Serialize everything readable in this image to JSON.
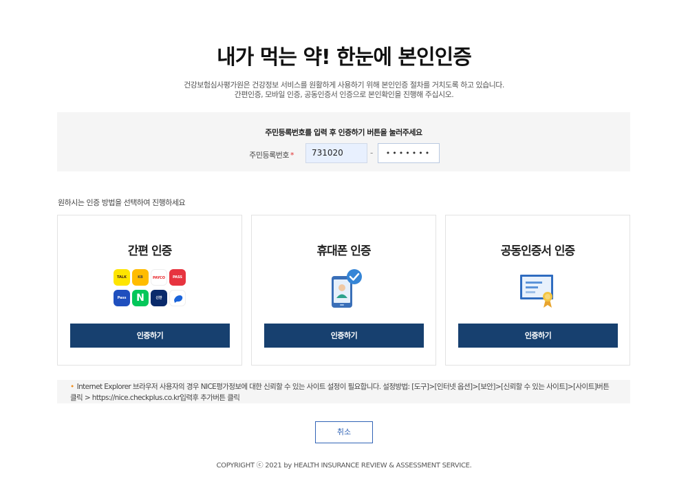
{
  "header": {
    "title": "내가 먹는 약! 한눈에 본인인증",
    "desc_line1": "건강보험심사평가원은 건강정보 서비스를 원활하게 사용하기 위해 본인인증 절차를 거치도록 하고 있습니다.",
    "desc_line2": "간편인증, 모바일 인증, 공동인증서 인증으로 본인확인을 진행해 주십시오."
  },
  "id_form": {
    "instruction": "주민등록번호를 입력 후 인증하기 버튼을 눌러주세요",
    "label": "주민등록번호",
    "required_mark": "*",
    "front_value": "731020",
    "separator": "-",
    "back_value": "•••••••"
  },
  "choose_text": "원하시는 인증 방법을 선택하여 진행하세요",
  "cards": [
    {
      "title": "간편 인증",
      "button": "인증하기"
    },
    {
      "title": "휴대폰 인증",
      "button": "인증하기"
    },
    {
      "title": "공동인증서 인증",
      "button": "인증하기"
    }
  ],
  "simple_auth_icons": [
    {
      "name": "kakao-icon",
      "text": "TALK",
      "bg": "#fee500",
      "fg": "#3a1d1d"
    },
    {
      "name": "kb-icon",
      "text": "KB",
      "bg": "#ffbc00",
      "fg": "#444"
    },
    {
      "name": "payco-icon",
      "text": "PAYCO",
      "bg": "#ffffff",
      "fg": "#e8262a"
    },
    {
      "name": "pass-icon",
      "text": "PASS",
      "bg": "#e7343f",
      "fg": "#fff"
    },
    {
      "name": "samsung-pass-icon",
      "text": "Pass",
      "bg": "#1f4fbe",
      "fg": "#fff"
    },
    {
      "name": "naver-icon",
      "text": "N",
      "bg": "#03c75a",
      "fg": "#fff"
    },
    {
      "name": "shinhan-icon",
      "text": "신한",
      "bg": "#0a2a6b",
      "fg": "#fff"
    },
    {
      "name": "toss-icon",
      "text": "",
      "bg": "#ffffff",
      "fg": "#1b64da"
    }
  ],
  "notice": {
    "line1": "Internet Explorer 브라우저 사용자의 경우 NICE평가정보에 대한 신뢰할 수 있는 사이트 설정이 필요합니다. 설정방법: [도구]>[인터넷 옵션]>[보안]>[신뢰할 수 있는 사이트]>[사이트]버튼",
    "line2": "클릭 > https://nice.checkplus.co.kr입력후 추가버튼 클릭"
  },
  "cancel_label": "취소",
  "copyright": "COPYRIGHT ⓒ 2021 by HEALTH INSURANCE  REVIEW & ASSESSMENT SERVICE.",
  "colors": {
    "primary": "#17406f",
    "accent": "#2f62b5",
    "required": "#e03030"
  }
}
